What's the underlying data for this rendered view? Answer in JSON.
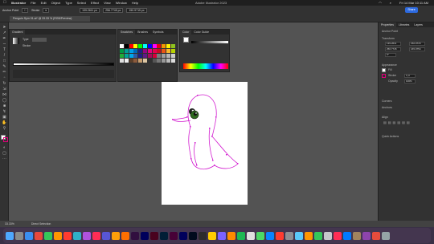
{
  "menubar": {
    "app_name": "Illustrator",
    "items": [
      "File",
      "Edit",
      "Object",
      "Type",
      "Select",
      "Effect",
      "View",
      "Window",
      "Help"
    ],
    "window_title": "Adobe Illustrator 2023",
    "clock": "Fri 14 Mar  10:11 AM"
  },
  "controlbar": {
    "selection_label": "Anchor Point",
    "stroke_label": "Stroke",
    "x_value": "139.2611 px",
    "y_value": "256.7745 px",
    "w_value": "150.9715 px",
    "share_label": "Share"
  },
  "document_tab": {
    "label": "Penguin Sym 01.ai* @ 33.33 % (RGB/Preview)"
  },
  "gradient_panel": {
    "tab": "Gradient",
    "type_label": "Type",
    "stroke_label": "Stroke"
  },
  "swatches_panel": {
    "tabs": [
      "Swatches",
      "Brushes",
      "Symbols"
    ],
    "colors": [
      "#ffffff",
      "#000000",
      "#ff0000",
      "#ffff00",
      "#00ff00",
      "#00ffff",
      "#0000ff",
      "#ff00ff",
      "#e60012",
      "#f39800",
      "#fff100",
      "#8fc31f",
      "#009944",
      "#009e96",
      "#00a0e9",
      "#0068b7",
      "#1d2088",
      "#920783",
      "#e4007f",
      "#e5004f",
      "#c30d23",
      "#ea5514",
      "#f8b62d",
      "#b8d200",
      "#22ac38",
      "#00a497",
      "#00a7eb",
      "#2e5aa6",
      "#1e1f86",
      "#601986",
      "#a40b5d",
      "#d7003a",
      "#7d7d7d",
      "#9f9f9f",
      "#b5b5b5",
      "#cccccc",
      "#e0e0e0",
      "#efefef",
      "#5a3f2a",
      "#8b5a3c",
      "#c69c6d",
      "#dcc5a2",
      "#313131",
      "#555555",
      "#777777",
      "#999999",
      "#bbbbbb",
      "#dddddd"
    ]
  },
  "color_panel": {
    "tabs": [
      "Color",
      "Color Guide"
    ]
  },
  "properties_panel": {
    "tabs": [
      "Properties",
      "Libraries",
      "Layers"
    ],
    "section_anchor": "Anchor Point",
    "section_transform": "Transform",
    "x": "139.2611",
    "y": "256.7745",
    "w": "150.9715",
    "h": "165.0754",
    "rotation": "0°",
    "section_appearance": "Appearance",
    "fill_label": "Fill",
    "stroke_label": "Stroke",
    "stroke_value": "1 pt",
    "opacity_label": "Opacity",
    "opacity_value": "100%",
    "section_align": "Align",
    "section_quick": "Quick Actions",
    "corners_label": "Corners",
    "anchors_label": "Anchors"
  },
  "statusbar": {
    "zoom": "33.33%",
    "tool": "Direct Selection"
  },
  "dock_icons": [
    "#4ea7ff",
    "#8a8a8a",
    "#3a8ef0",
    "#e8483b",
    "#34c759",
    "#ff9500",
    "#ff3b30",
    "#30b0c7",
    "#af52de",
    "#ff2d55",
    "#5856d6",
    "#ff9f0a",
    "#ff6f00",
    "#310f3f",
    "#00005b",
    "#49021f",
    "#001e36",
    "#470137",
    "#00005b",
    "#000b1d",
    "#2c2c2c",
    "#ffcc00",
    "#7b61ff",
    "#ff8a00",
    "#1db954",
    "#e0e0e0",
    "#4cd964",
    "#0a84ff",
    "#ff3b30",
    "#8e8e93",
    "#5ac8fa",
    "#ff9500",
    "#34c759",
    "#c7c7cc",
    "#ff2d55",
    "#007aff",
    "#a2845e",
    "#8e44ad",
    "#e74c3c",
    "#95a5a6"
  ]
}
